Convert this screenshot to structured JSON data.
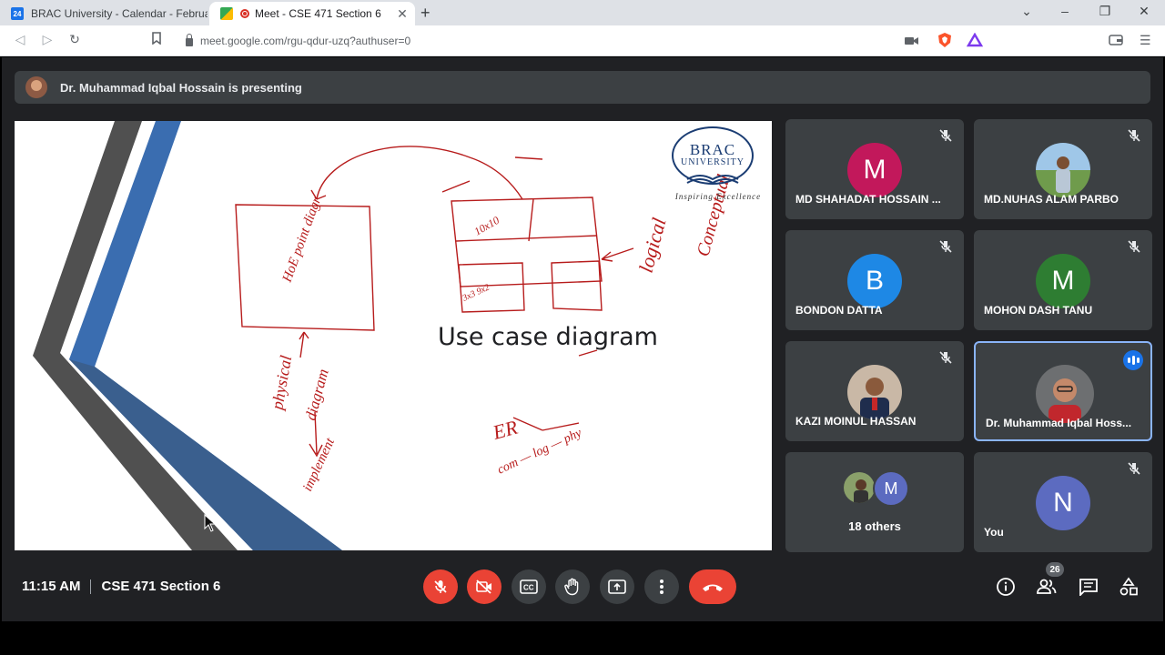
{
  "browser": {
    "tabs": [
      {
        "title": "BRAC University - Calendar - February",
        "active": false,
        "favicon_text": "24"
      },
      {
        "title": "Meet - CSE 471 Section 6",
        "active": true
      }
    ],
    "url": "meet.google.com/rgu-qdur-uzq?authuser=0"
  },
  "meet": {
    "presenting_text": "Dr. Muhammad Iqbal Hossain is presenting",
    "slide": {
      "title": "Use case diagram",
      "logo_name": "BRAC",
      "logo_sub": "UNIVERSITY",
      "logo_tagline": "Inspiring Excellence",
      "handwriting": {
        "box_label": "HoE point diagr",
        "grid_top": "10x10",
        "grid_bottom": "3x3 9x2",
        "logical": "logical",
        "conceptual": "Conceptual",
        "physical": "physical",
        "diagram": "diagram",
        "implement": "implement",
        "er": "ER",
        "com_log_phy": "com — log — phy"
      }
    },
    "participants": [
      {
        "name": "MD SHAHADAT HOSSAIN ...",
        "initial": "M",
        "color": "#c2185b",
        "muted": true
      },
      {
        "name": "MD.NUHAS ALAM PARBO",
        "photo": true,
        "muted": true
      },
      {
        "name": "BONDON DATTA",
        "initial": "B",
        "color": "#1e88e5",
        "muted": true
      },
      {
        "name": "MOHON DASH TANU",
        "initial": "M",
        "color": "#2e7d32",
        "muted": true
      },
      {
        "name": "KAZI MOINUL HASSAN",
        "photo": true,
        "muted": true
      },
      {
        "name": "Dr. Muhammad Iqbal Hoss...",
        "photo": true,
        "speaking": true
      },
      {
        "name": "18 others",
        "initial": "M",
        "color": "#5c6bc0"
      },
      {
        "name": "You",
        "initial": "N",
        "color": "#5c6bc0",
        "muted": true
      }
    ],
    "bottom": {
      "time": "11:15 AM",
      "meeting_name": "CSE 471 Section 6",
      "people_count": "26"
    }
  },
  "colors": {
    "meet_bg": "#202124",
    "tile_bg": "#3c4043",
    "danger": "#ea4335",
    "ink": "#b71c1c"
  }
}
